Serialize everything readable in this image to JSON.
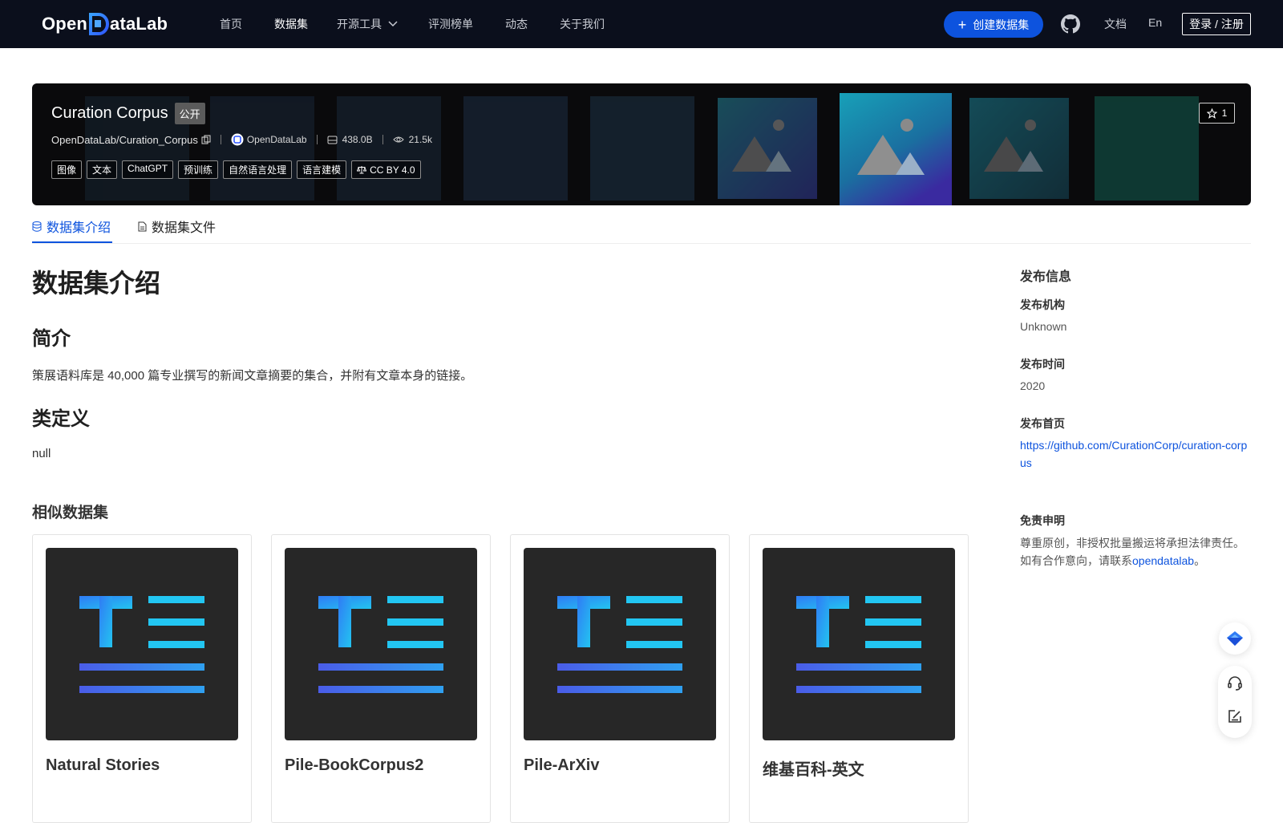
{
  "nav": {
    "logo_text_left": "Open",
    "logo_text_right": "ataLab",
    "items": [
      {
        "label": "首页"
      },
      {
        "label": "数据集"
      },
      {
        "label": "开源工具"
      },
      {
        "label": "评测榜单"
      },
      {
        "label": "动态"
      },
      {
        "label": "关于我们"
      }
    ],
    "create_label": "创建数据集",
    "docs_label": "文档",
    "lang_label": "En",
    "login_label": "登录 / 注册"
  },
  "dataset": {
    "name": "Curation Corpus",
    "visibility": "公开",
    "path": "OpenDataLab/Curation_Corpus",
    "publisher": "OpenDataLab",
    "size": "438.0B",
    "views": "21.5k",
    "tags": [
      "图像",
      "文本",
      "ChatGPT",
      "预训练",
      "自然语言处理",
      "语言建模"
    ],
    "license": "CC BY 4.0",
    "stars": "1"
  },
  "tabs": [
    {
      "label": "数据集介绍"
    },
    {
      "label": "数据集文件"
    }
  ],
  "content": {
    "heading": "数据集介绍",
    "intro_heading": "简介",
    "intro_text": "策展语料库是 40,000 篇专业撰写的新闻文章摘要的集合，并附有文章本身的链接。",
    "class_heading": "类定义",
    "class_text": "null",
    "similar_heading": "相似数据集",
    "similar": [
      {
        "title": "Natural Stories"
      },
      {
        "title": "Pile-BookCorpus2"
      },
      {
        "title": "Pile-ArXiv"
      },
      {
        "title": "维基百科-英文"
      }
    ]
  },
  "sidebar": {
    "heading": "发布信息",
    "org_label": "发布机构",
    "org_value": "Unknown",
    "time_label": "发布时间",
    "time_value": "2020",
    "home_label": "发布首页",
    "home_value": "https://github.com/CurationCorp/curation-corpus",
    "disclaimer_label": "免责申明",
    "disclaimer_line1": "尊重原创，非授权批量搬运将承担法律责任。",
    "disclaimer_line2_prefix": "如有合作意向，请联系",
    "disclaimer_link": "opendatalab",
    "disclaimer_line2_suffix": "。"
  },
  "colors": {
    "nav_bg": "#0b0f1c",
    "accent": "#0d53de",
    "banner_bg": "#0a0a0c"
  },
  "icons": [
    "logo-d-icon",
    "chevron-down-icon",
    "plus-icon",
    "github-icon",
    "copy-icon",
    "org-icon",
    "storage-icon",
    "eye-icon",
    "scale-icon",
    "star-icon",
    "database-icon",
    "file-icon",
    "feedback-icon",
    "headset-icon",
    "edit-icon"
  ]
}
